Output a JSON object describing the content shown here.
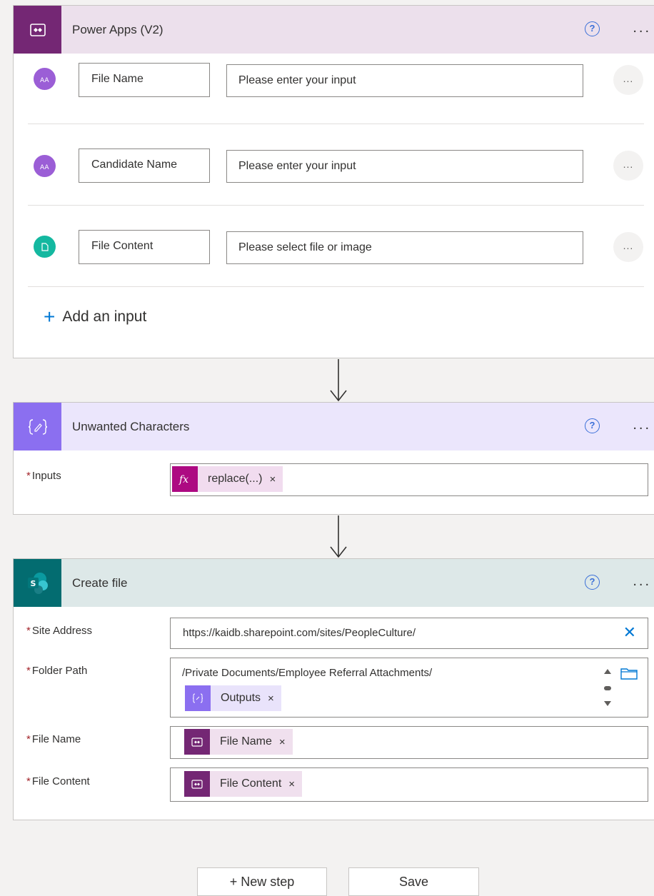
{
  "trigger": {
    "title": "Power Apps (V2)",
    "help": "?",
    "more": "...",
    "inputs": [
      {
        "name": "File Name",
        "placeholder": "Please enter your input",
        "type_icon": "text-type-icon"
      },
      {
        "name": "Candidate Name",
        "placeholder": "Please enter your input",
        "type_icon": "text-type-icon"
      },
      {
        "name": "File Content",
        "placeholder": "Please select file or image",
        "type_icon": "file-type-icon"
      }
    ],
    "row_more": "...",
    "add_input": "Add an input",
    "add_input_plus": "+"
  },
  "compose": {
    "title": "Unwanted Characters",
    "help": "?",
    "more": "...",
    "inputs_label": "Inputs",
    "required_mark": "*",
    "token": {
      "label": "replace(...)",
      "remove": "×",
      "icon": "fx-icon"
    }
  },
  "create_file": {
    "title": "Create file",
    "help": "?",
    "more": "...",
    "required_mark": "*",
    "site_address": {
      "label": "Site Address",
      "value": "https://kaidb.sharepoint.com/sites/PeopleCulture/",
      "clear": "✕"
    },
    "folder_path": {
      "label": "Folder Path",
      "value": "/Private Documents/Employee Referral Attachments/",
      "token": {
        "label": "Outputs",
        "remove": "×"
      }
    },
    "file_name": {
      "label": "File Name",
      "token": {
        "label": "File Name",
        "remove": "×"
      }
    },
    "file_content": {
      "label": "File Content",
      "token": {
        "label": "File Content",
        "remove": "×"
      }
    }
  },
  "footer": {
    "new_step": "+ New step",
    "save": "Save"
  },
  "colors": {
    "power_apps": "#742774",
    "compose": "#8b6ff0",
    "sharepoint": "#036c70",
    "accent": "#0078d4",
    "required": "#a4262c"
  }
}
